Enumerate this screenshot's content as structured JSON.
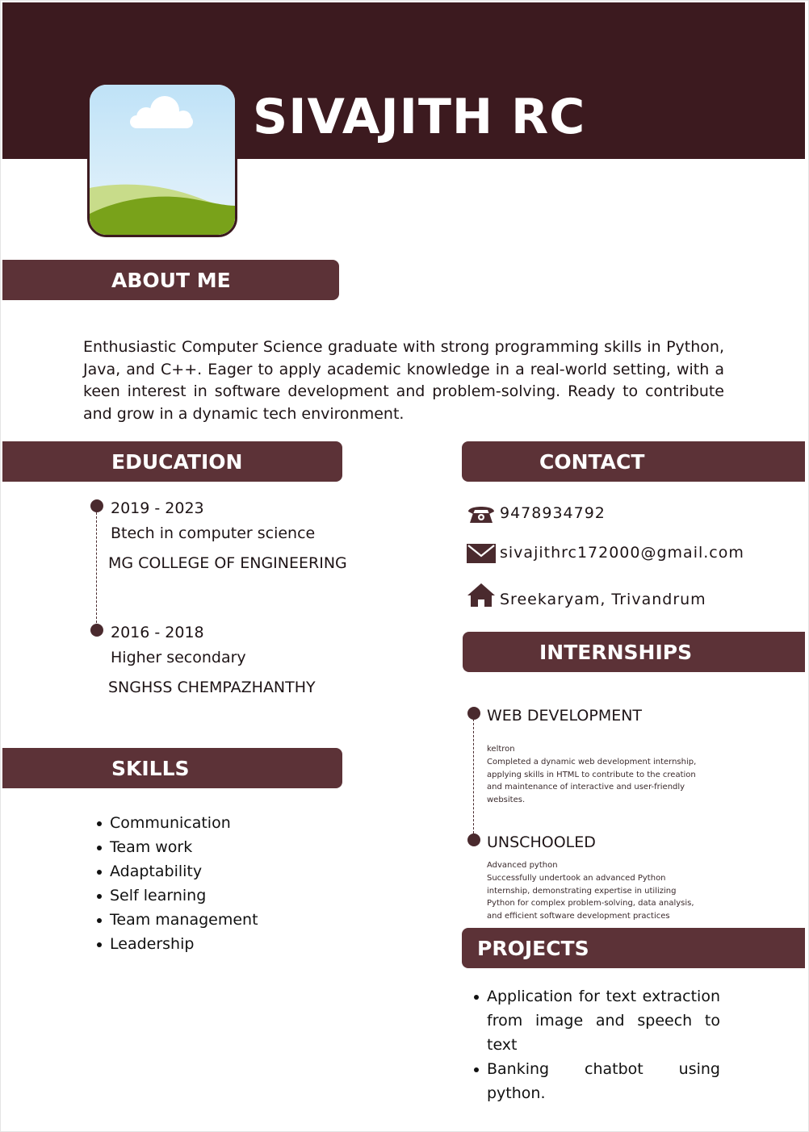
{
  "header": {
    "name": "SIVAJITH RC"
  },
  "about": {
    "title": "ABOUT ME",
    "text": "Enthusiastic Computer Science graduate with strong programming skills in Python, Java, and C++. Eager to apply academic knowledge in a real-world setting, with a keen interest in software development and problem-solving. Ready to contribute and grow in a dynamic tech environment."
  },
  "education": {
    "title": "EDUCATION",
    "items": [
      {
        "years": "2019 - 2023",
        "degree": "Btech in computer science",
        "school": "MG COLLEGE OF ENGINEERING"
      },
      {
        "years": "2016 - 2018",
        "degree": "Higher secondary",
        "school": "SNGHSS CHEMPAZHANTHY"
      }
    ]
  },
  "contact": {
    "title": "CONTACT",
    "phone": "9478934792",
    "email": "sivajithrc172000@gmail.com",
    "address": "Sreekaryam, Trivandrum"
  },
  "internships": {
    "title": "INTERNSHIPS",
    "items": [
      {
        "title": "WEB DEVELOPMENT",
        "org": "keltron",
        "desc": "Completed a dynamic web development internship, applying skills in HTML to contribute to the creation and maintenance of interactive and user-friendly websites."
      },
      {
        "title": "UNSCHOOLED",
        "org": "Advanced python",
        "desc": "Successfully undertook an advanced Python internship, demonstrating expertise in utilizing Python for complex problem-solving, data analysis, and efficient software development practices"
      }
    ]
  },
  "skills": {
    "title": "SKILLS",
    "items": [
      "Communication",
      "Team work",
      "Adaptability",
      "Self learning",
      "Team management",
      "Leadership"
    ]
  },
  "projects": {
    "title": "PROJECTS",
    "items": [
      "Application for text extraction from image and speech to text",
      "Banking chatbot using python."
    ]
  },
  "icons": {
    "phone": "phone-icon",
    "email": "envelope-icon",
    "address": "home-icon"
  },
  "colors": {
    "dark": "#3c1a1f",
    "bar": "#5c3237",
    "text": "#1e1416"
  }
}
